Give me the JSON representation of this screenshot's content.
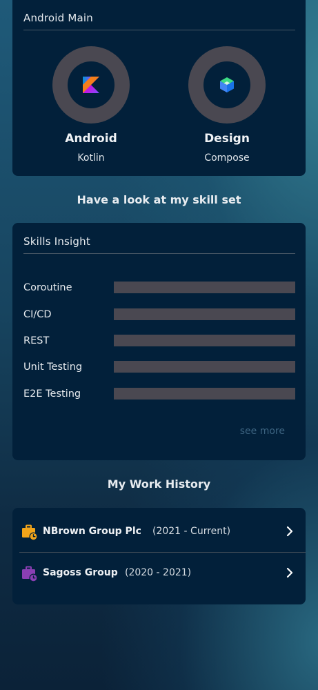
{
  "main_card": {
    "title": "Android Main",
    "skills": [
      {
        "name": "Android",
        "sub": "Kotlin",
        "icon": "kotlin-icon"
      },
      {
        "name": "Design",
        "sub": "Compose",
        "icon": "jetpack-compose-icon"
      }
    ]
  },
  "skills_heading": "Have a look at my skill set",
  "skills_card": {
    "title": "Skills Insight",
    "items": [
      {
        "label": "Coroutine",
        "level": 1.0
      },
      {
        "label": "CI/CD",
        "level": 1.0
      },
      {
        "label": "REST",
        "level": 1.0
      },
      {
        "label": "Unit Testing",
        "level": 1.0
      },
      {
        "label": "E2E Testing",
        "level": 1.0
      }
    ],
    "see_more": "see more"
  },
  "work_heading": "My Work History",
  "work_card": {
    "items": [
      {
        "company": "NBrown Group Plc",
        "period": "(2021 - Current)",
        "icon": "briefcase-clock-icon",
        "icon_color": "#f2a51a"
      },
      {
        "company": "Sagoss Group",
        "period": "(2020 - 2021)",
        "icon": "briefcase-clock-icon",
        "icon_color": "#8a3fb3"
      }
    ]
  },
  "colors": {
    "card_bg": "#02203a",
    "ring": "#4a4851",
    "bar": "#4a4851",
    "link": "#3d6481"
  }
}
